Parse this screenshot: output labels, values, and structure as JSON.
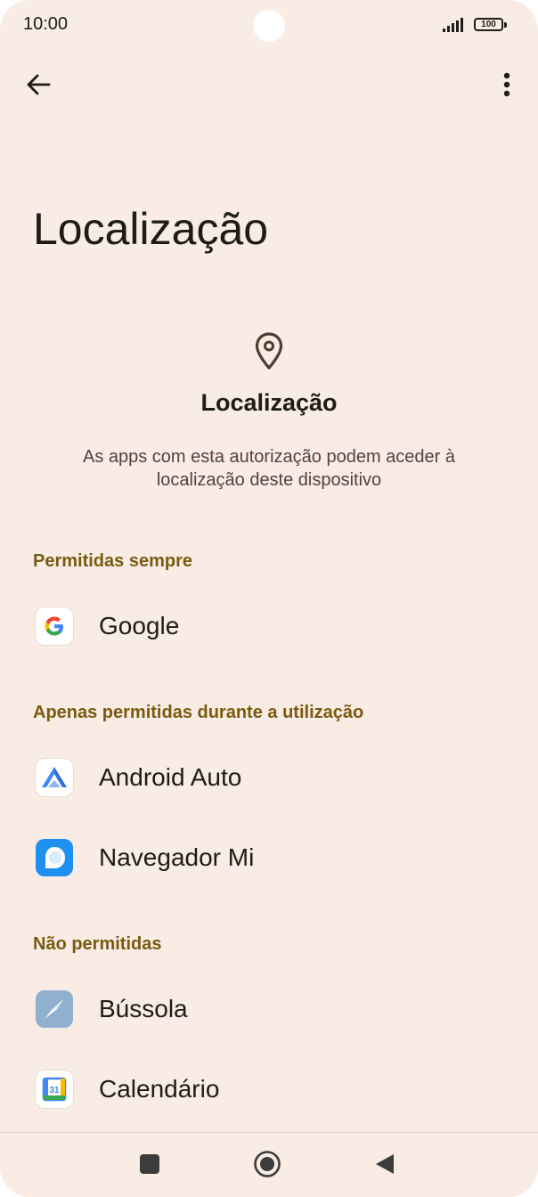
{
  "status_bar": {
    "time": "10:00",
    "battery": "100"
  },
  "app_bar": {
    "back_icon": "arrow-left-icon",
    "menu_icon": "more-vertical-icon"
  },
  "page": {
    "title": "Localização"
  },
  "permission": {
    "icon": "location-pin-icon",
    "heading": "Localização",
    "description": "As apps com esta autorização podem aceder à localização deste dispositivo"
  },
  "groups": [
    {
      "header": "Permitidas sempre",
      "apps": [
        {
          "label": "Google",
          "icon": "google-icon"
        }
      ]
    },
    {
      "header": "Apenas permitidas durante a utilização",
      "apps": [
        {
          "label": "Android Auto",
          "icon": "android-auto-icon"
        },
        {
          "label": "Navegador Mi",
          "icon": "mi-browser-icon"
        }
      ]
    },
    {
      "header": "Não permitidas",
      "apps": [
        {
          "label": "Bússola",
          "icon": "compass-icon"
        },
        {
          "label": "Calendário",
          "icon": "calendar-icon"
        }
      ]
    }
  ],
  "calendar_icon_day": "31",
  "nav_bar": {
    "recents_icon": "square-recents-icon",
    "home_icon": "circle-home-icon",
    "back_icon": "triangle-back-icon"
  },
  "colors": {
    "background": "#f8ece4",
    "group_header": "#7a5a10",
    "text": "#1f1b16"
  }
}
